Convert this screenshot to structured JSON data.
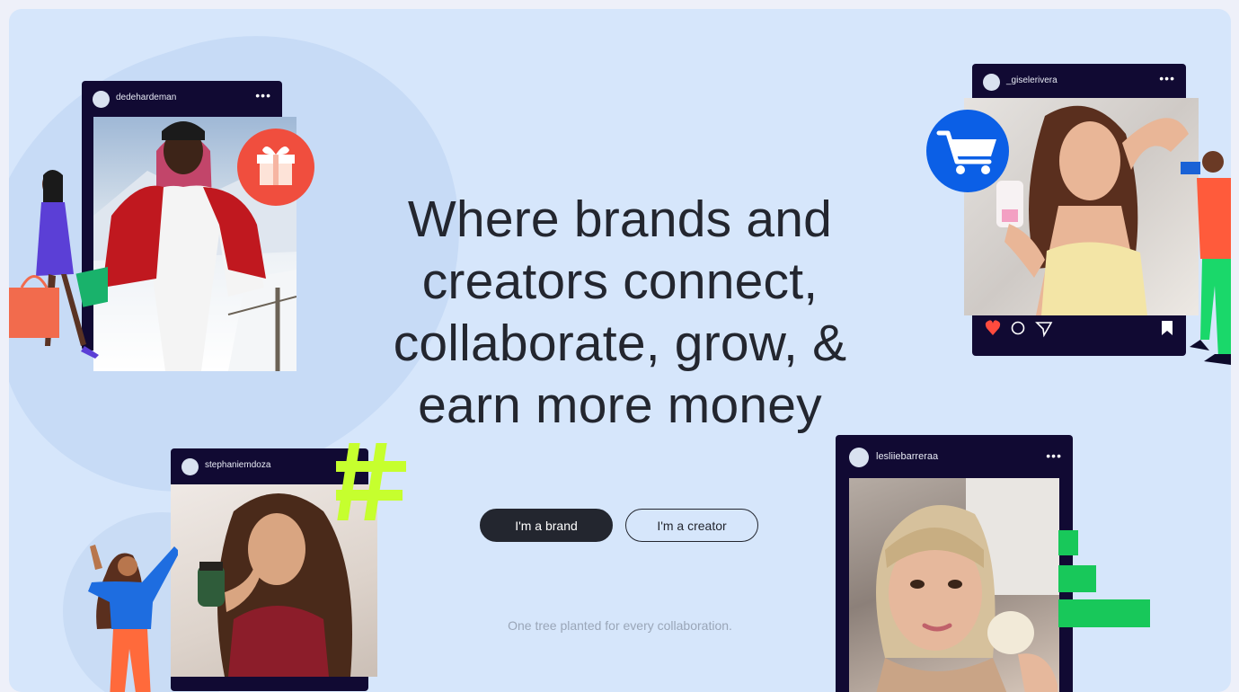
{
  "headline": "Where brands and creators connect, collaborate, grow, & earn more money",
  "buttons": {
    "brand": "I'm a brand",
    "creator": "I'm a creator"
  },
  "tagline": "One tree planted for every collaboration.",
  "cards": [
    {
      "username": "dedehardeman",
      "menu": "•••",
      "badge": "gift-icon"
    },
    {
      "username": "_giselerivera",
      "menu": "•••",
      "badge": "shopping-cart-icon"
    },
    {
      "username": "stephaniemdoza",
      "badge": "hashtag-icon"
    },
    {
      "username": "lesliiebarreraa",
      "menu": "•••"
    }
  ],
  "colors": {
    "background": "#d6e6fb",
    "card": "#110a33",
    "primary_button": "#23262f",
    "gift_badge": "#f04e3e",
    "cart_badge": "#0b5fe6",
    "hashtag": "#c6ff2e",
    "green_accent": "#18c85a"
  }
}
